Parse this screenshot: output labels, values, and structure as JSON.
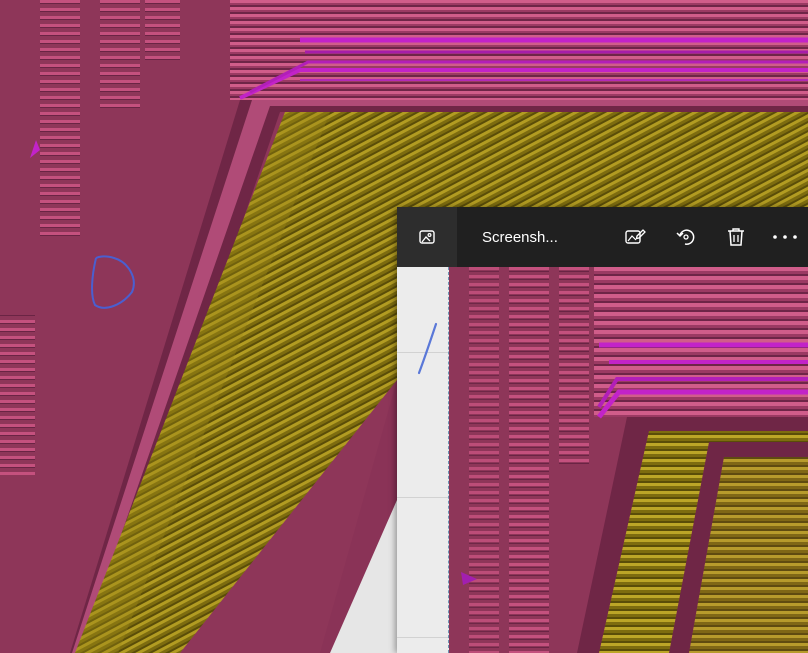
{
  "viewer": {
    "title": "Screensh...",
    "toolbar": {
      "app_icon": "image-icon",
      "edit_icon": "edit-image-icon",
      "rotate_icon": "rotate-icon",
      "delete_icon": "trash-icon",
      "more_icon": "more-options-icon"
    }
  },
  "colors": {
    "magenta_wall": "#8e3659",
    "ridge": "#c85080",
    "purple_travel": "#c223c8",
    "olive_infill": "#8a7a12",
    "titlebar": "#202020",
    "ink": "#4a5fd0"
  }
}
